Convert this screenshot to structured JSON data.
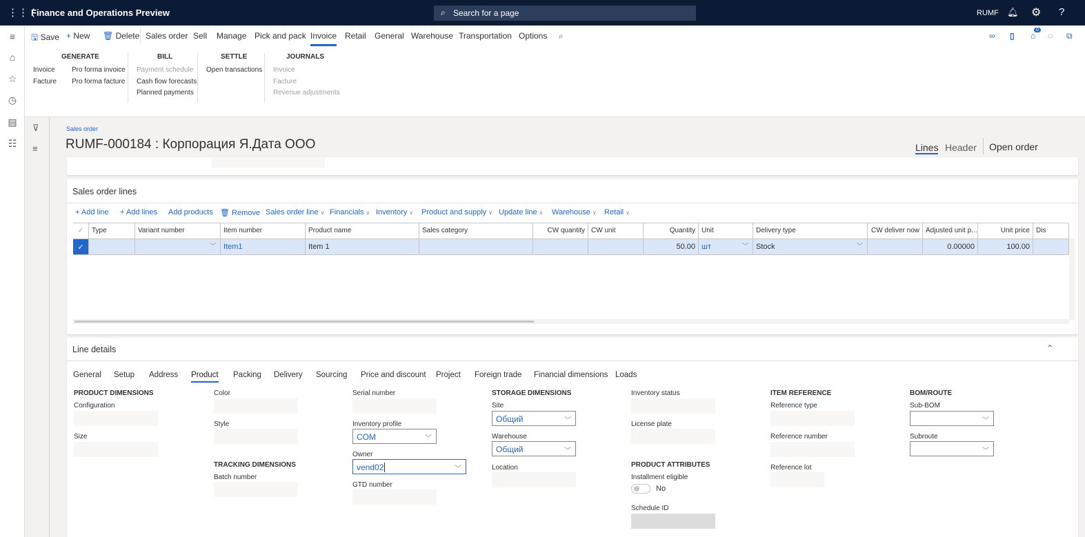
{
  "app": {
    "title": "Finance and Operations Preview",
    "search_placeholder": "Search for a page",
    "company": "RUMF",
    "notification_badge": "0"
  },
  "icons": {
    "waffle": "waffle-icon",
    "bell": "bell-icon",
    "gear": "gear-icon",
    "help": "help-icon"
  },
  "actionbar": {
    "save": "Save",
    "new": "New",
    "delete": "Delete",
    "tabs": [
      "Sales order",
      "Sell",
      "Manage",
      "Pick and pack",
      "Invoice",
      "Retail",
      "General",
      "Warehouse",
      "Transportation",
      "Options"
    ],
    "active_tab": "Invoice"
  },
  "ribbon": {
    "generate": {
      "title": "GENERATE",
      "items": [
        "Invoice",
        "Facture",
        "Pro forma invoice",
        "Pro forma facture"
      ]
    },
    "bill": {
      "title": "BILL",
      "items": [
        "Payment schedule",
        "Cash flow forecasts",
        "Planned payments"
      ]
    },
    "settle": {
      "title": "SETTLE",
      "items": [
        "Open transactions"
      ]
    },
    "journals": {
      "title": "JOURNALS",
      "items": [
        "Invoice",
        "Facture",
        "Revenue adjustments"
      ]
    }
  },
  "page": {
    "breadcrumb": "Sales order",
    "title": "RUMF-000184 : Корпорация Я.Дата ООО",
    "view_lines": "Lines",
    "view_header": "Header",
    "open_order": "Open order"
  },
  "lines": {
    "title": "Sales order lines",
    "toolbar": [
      "Add line",
      "Add lines",
      "Add products",
      "Remove",
      "Sales order line",
      "Financials",
      "Inventory",
      "Product and supply",
      "Update line",
      "Warehouse",
      "Retail"
    ],
    "columns": [
      "Type",
      "Variant number",
      "Item number",
      "Product name",
      "Sales category",
      "CW quantity",
      "CW unit",
      "Quantity",
      "Unit",
      "Delivery type",
      "CW deliver now",
      "Adjusted unit p...",
      "Unit price",
      "Dis"
    ],
    "rows": [
      {
        "type": "",
        "variant": "",
        "item": "Item1",
        "product": "Item 1",
        "category": "",
        "cw_qty": "",
        "cw_unit": "",
        "qty": "50.00",
        "unit": "шт",
        "delivery": "Stock",
        "cw_deliver": "",
        "adj_price": "0.00000",
        "unit_price": "100.00"
      }
    ]
  },
  "details": {
    "title": "Line details",
    "tabs": [
      "General",
      "Setup",
      "Address",
      "Product",
      "Packing",
      "Delivery",
      "Sourcing",
      "Price and discount",
      "Project",
      "Foreign trade",
      "Financial dimensions",
      "Loads"
    ],
    "active_tab": "Product",
    "product_dimensions": "PRODUCT DIMENSIONS",
    "configuration": "Configuration",
    "size": "Size",
    "color": "Color",
    "style": "Style",
    "tracking_dimensions": "TRACKING DIMENSIONS",
    "batch_number": "Batch number",
    "serial_number": "Serial number",
    "inventory_profile": "Inventory profile",
    "inventory_profile_value": "COM",
    "owner": "Owner",
    "owner_value": "vend02",
    "gtd_number": "GTD number",
    "storage_dimensions": "STORAGE DIMENSIONS",
    "site": "Site",
    "site_value": "Общий",
    "warehouse": "Warehouse",
    "warehouse_value": "Общий",
    "location": "Location",
    "inventory_status": "Inventory status",
    "license_plate": "License plate",
    "product_attributes": "PRODUCT ATTRIBUTES",
    "installment_eligible": "Installment eligible",
    "installment_value": "No",
    "schedule_id": "Schedule ID",
    "item_reference": "ITEM REFERENCE",
    "reference_type": "Reference type",
    "reference_number": "Reference number",
    "reference_lot": "Reference lot",
    "bom_route": "BOM/ROUTE",
    "sub_bom": "Sub-BOM",
    "subroute": "Subroute"
  }
}
